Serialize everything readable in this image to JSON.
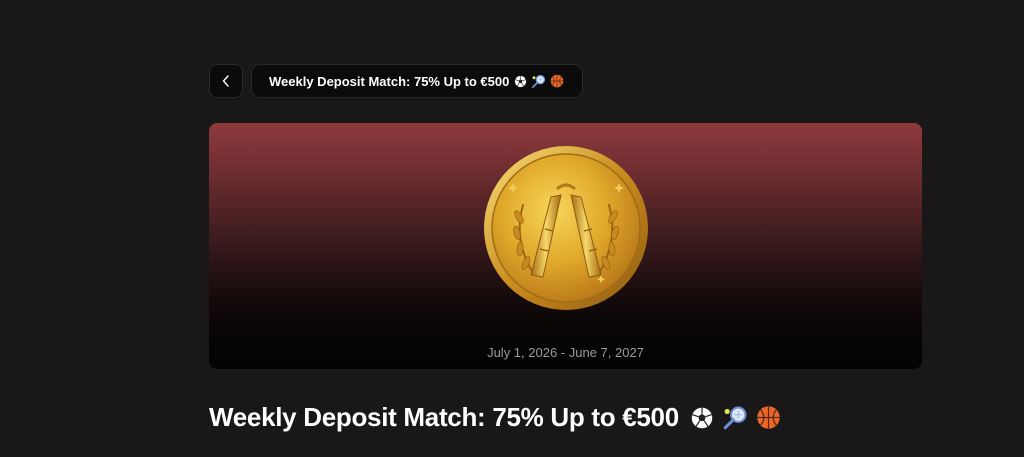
{
  "header": {
    "back_icon": "chevron-left-icon",
    "pill_title": "Weekly Deposit Match: 75% Up to €500",
    "sport_icons": [
      "soccer-ball-icon",
      "tennis-racket-icon",
      "basketball-icon"
    ]
  },
  "banner": {
    "image": "gold-nunchaku-medal",
    "date_range": "July 1, 2026 - June 7, 2027"
  },
  "main": {
    "title": "Weekly Deposit Match: 75% Up to €500"
  },
  "colors": {
    "background": "#191718",
    "banner_top": "#8f3a3d",
    "banner_bottom": "#030303",
    "coin_gold": "#e0a82a"
  }
}
